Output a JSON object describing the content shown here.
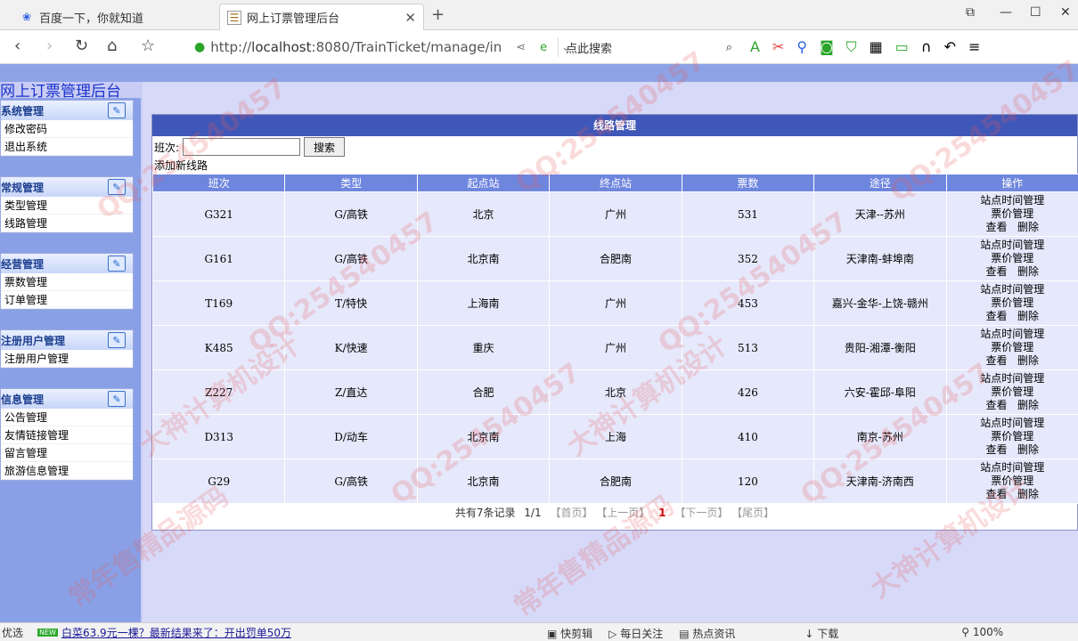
{
  "browser": {
    "tabs": [
      {
        "title": "百度一下，你就知道",
        "active": false
      },
      {
        "title": "网上订票管理后台",
        "active": true
      }
    ],
    "new_tab": "+",
    "window_controls": [
      "⧉",
      "—",
      "☐",
      "✕"
    ],
    "url": {
      "prefix": "http://",
      "host": "localhost",
      "rest": ":8080/TrainTicket/manage/in"
    },
    "search_placeholder": "点此搜索"
  },
  "app": {
    "title": "网上订票管理后台"
  },
  "sidebar": {
    "menus": [
      {
        "header": "系统管理",
        "items": [
          "修改密码",
          "退出系统"
        ]
      },
      {
        "header": "常规管理",
        "items": [
          "类型管理",
          "线路管理"
        ]
      },
      {
        "header": "经营管理",
        "items": [
          "票数管理",
          "订单管理"
        ]
      },
      {
        "header": "注册用户管理",
        "items": [
          "注册用户管理"
        ]
      },
      {
        "header": "信息管理",
        "items": [
          "公告管理",
          "友情链接管理",
          "留言管理",
          "旅游信息管理"
        ]
      }
    ]
  },
  "main": {
    "title": "线路管理",
    "filter_label": "班次:",
    "search_value": "",
    "search_button": "搜索",
    "add_link": "添加新线路",
    "columns": [
      "班次",
      "类型",
      "起点站",
      "终点站",
      "票数",
      "途径",
      "操作"
    ],
    "rows": [
      {
        "code": "G321",
        "type": "G/高铁",
        "from": "北京",
        "to": "广州",
        "count": "531",
        "via": "天津--苏州"
      },
      {
        "code": "G161",
        "type": "G/高铁",
        "from": "北京南",
        "to": "合肥南",
        "count": "352",
        "via": "天津南-蚌埠南"
      },
      {
        "code": "T169",
        "type": "T/特快",
        "from": "上海南",
        "to": "广州",
        "count": "453",
        "via": "嘉兴-金华-上饶-赣州"
      },
      {
        "code": "K485",
        "type": "K/快速",
        "from": "重庆",
        "to": "广州",
        "count": "513",
        "via": "贵阳-湘潭-衡阳"
      },
      {
        "code": "Z227",
        "type": "Z/直达",
        "from": "合肥",
        "to": "北京",
        "count": "426",
        "via": "六安-霍邱-阜阳"
      },
      {
        "code": "D313",
        "type": "D/动车",
        "from": "北京南",
        "to": "上海",
        "count": "410",
        "via": "南京-苏州"
      },
      {
        "code": "G29",
        "type": "G/高铁",
        "from": "北京南",
        "to": "合肥南",
        "count": "120",
        "via": "天津南-济南西"
      }
    ],
    "ops": {
      "station_time": "站点时间管理",
      "price": "票价管理",
      "view": "查看",
      "delete": "删除"
    },
    "pager": {
      "summary": "共有7条记录",
      "page": "1/1",
      "first": "【首页】",
      "prev": "【上一页】",
      "current": "1",
      "next": "【下一页】",
      "last": "【尾页】"
    }
  },
  "statusbar": {
    "left": "优选",
    "badge": "NEW",
    "news": "白菜63.9元一棵？最新结果来了：开出罚单50万",
    "items": [
      "快剪辑",
      "每日关注",
      "热点资讯",
      "下载",
      "100%"
    ]
  },
  "watermark": [
    "QQ:254540457",
    "常年售精品源码",
    "大神计算机设计"
  ]
}
